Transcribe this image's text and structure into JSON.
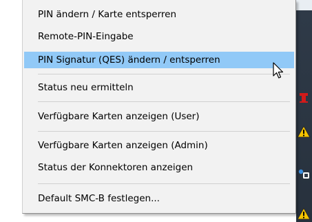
{
  "menu": {
    "items": [
      {
        "label": "PIN ändern / Karte entsperren"
      },
      {
        "label": "Remote-PIN-Eingabe"
      },
      {
        "label": "PIN Signatur (QES) ändern / entsperren",
        "highlighted": true
      },
      {
        "label": "Status neu ermitteln"
      },
      {
        "label": "Verfügbare Karten anzeigen (User)"
      },
      {
        "label": "Verfügbare Karten anzeigen (Admin)"
      },
      {
        "label": "Status der Konnektoren anzeigen"
      },
      {
        "label": "Default SMC-B festlegen..."
      }
    ]
  },
  "colors": {
    "menu_background": "#f2f2f2",
    "highlight": "#91c9f7",
    "separator": "#d0d0d0",
    "taskbar": "#2f3a48"
  },
  "tray": {
    "icons": [
      "red-app-icon",
      "warning-icon",
      "user-device-icon",
      "warning-icon"
    ]
  }
}
